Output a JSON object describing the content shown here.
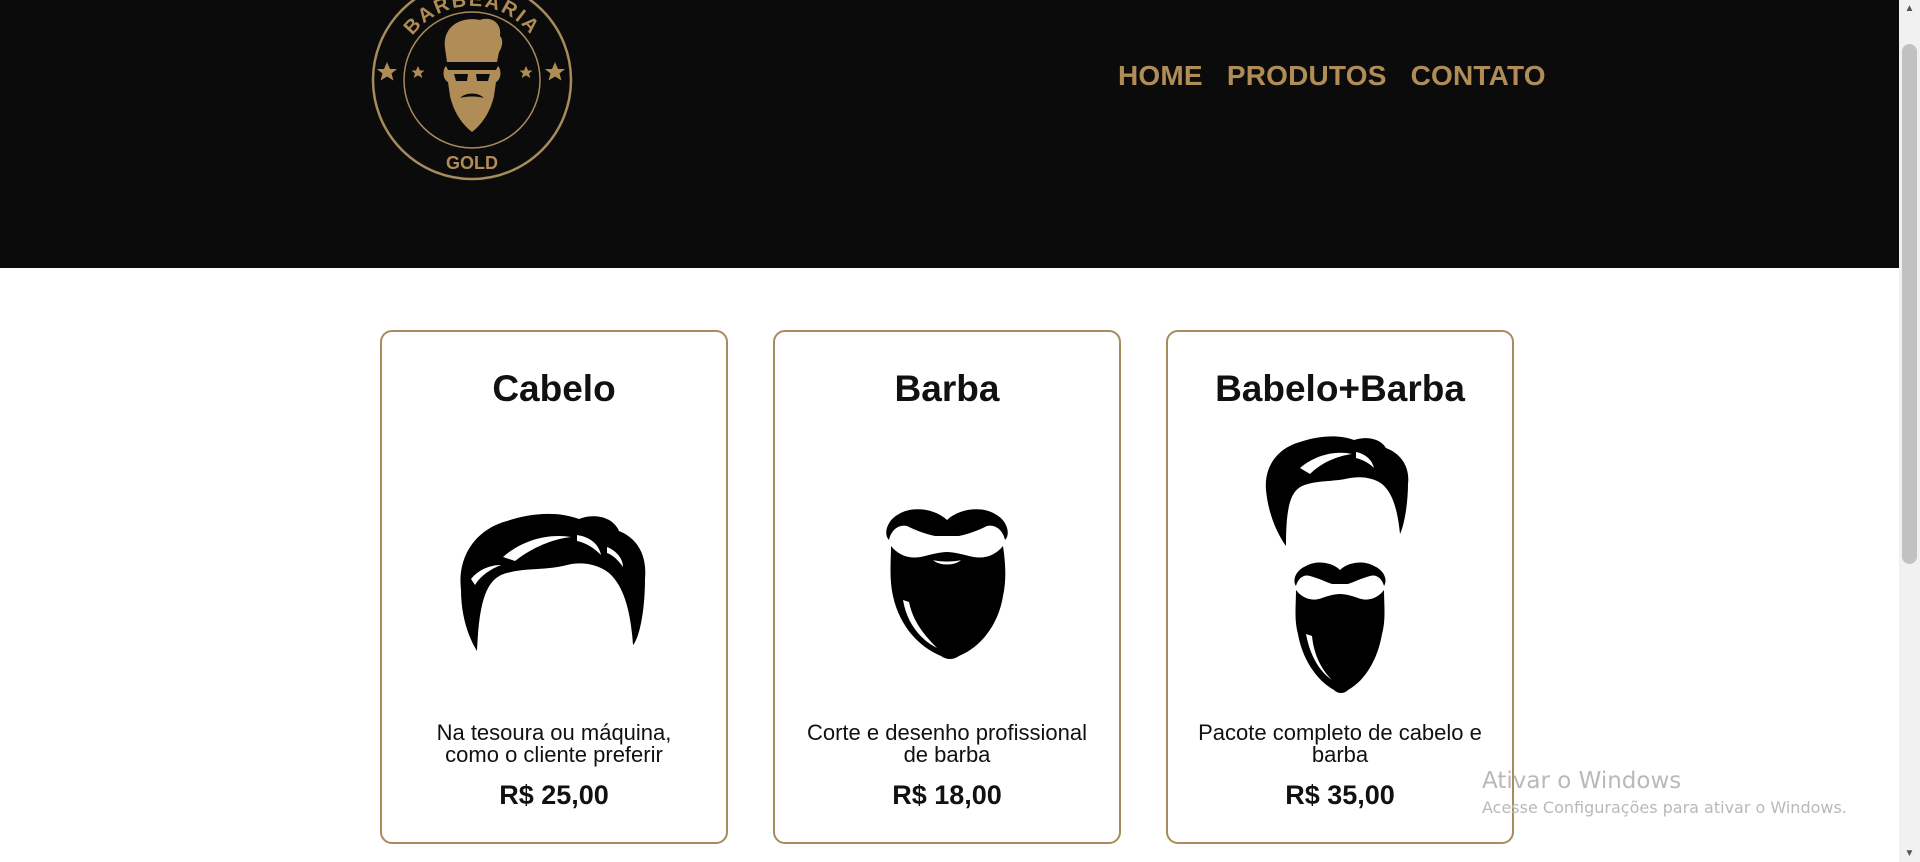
{
  "brand": {
    "logo_top_text": "BARBEARIA",
    "logo_bottom_text": "GOLD",
    "gold_color": "#b08d57",
    "header_bg": "#0b0b0b"
  },
  "nav": {
    "items": [
      {
        "label": "HOME"
      },
      {
        "label": "PRODUTOS"
      },
      {
        "label": "CONTATO"
      }
    ]
  },
  "products": [
    {
      "title": "Cabelo",
      "icon": "hair-icon",
      "description": "Na tesoura ou máquina, como o cliente preferir",
      "price": "R$ 25,00"
    },
    {
      "title": "Barba",
      "icon": "beard-icon",
      "description": "Corte e desenho profissional de barba",
      "price": "R$ 18,00"
    },
    {
      "title": "Babelo+Barba",
      "icon": "hair-and-beard-icon",
      "description": "Pacote completo de cabelo e barba",
      "price": "R$ 35,00"
    }
  ],
  "watermark": {
    "title": "Ativar o Windows",
    "subtitle": "Acesse Configurações para ativar o Windows."
  }
}
